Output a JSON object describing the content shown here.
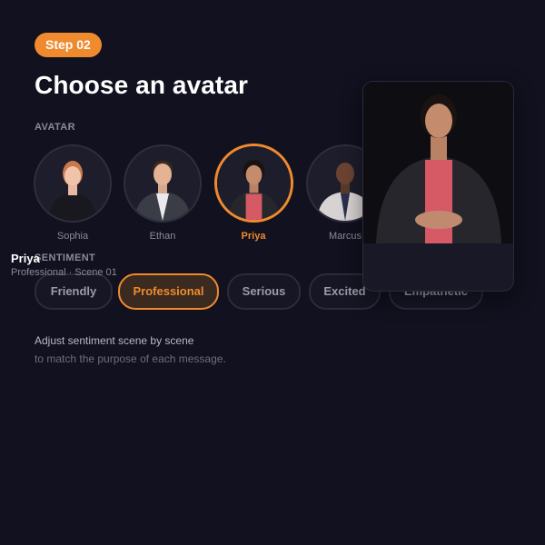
{
  "step": {
    "label": "Step 02"
  },
  "title": "Choose an avatar",
  "avatar_section": {
    "label": "AVATAR",
    "items": [
      {
        "name": "Sophia",
        "selected": false
      },
      {
        "name": "Ethan",
        "selected": false
      },
      {
        "name": "Priya",
        "selected": true
      },
      {
        "name": "Marcus",
        "selected": false
      }
    ]
  },
  "sentiment_section": {
    "label": "SENTIMENT",
    "options": [
      {
        "label": "Friendly",
        "selected": false
      },
      {
        "label": "Professional",
        "selected": true
      },
      {
        "label": "Serious",
        "selected": false
      },
      {
        "label": "Excited",
        "selected": false
      },
      {
        "label": "Empathetic",
        "selected": false
      }
    ]
  },
  "helper": {
    "line1": "Adjust sentiment scene by scene",
    "line2": "to match the purpose of each message."
  },
  "preview": {
    "name": "Priya",
    "meta": "Professional · Scene 01"
  },
  "colors": {
    "background": "#11111f",
    "accent": "#f08a2e",
    "muted_text": "#8a8a9a"
  }
}
